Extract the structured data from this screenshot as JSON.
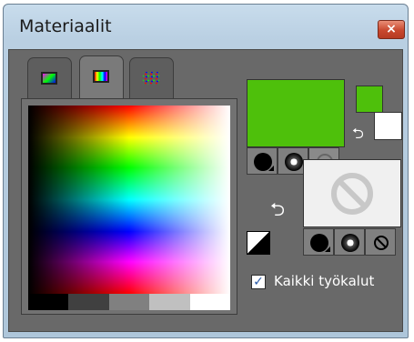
{
  "window": {
    "title": "Materiaalit",
    "close_label": "×"
  },
  "tabs": [
    {
      "name": "frame-tab-icon"
    },
    {
      "name": "gradient-tab-icon"
    },
    {
      "name": "pattern-tab-icon"
    }
  ],
  "colors": {
    "foreground": "#4ec00b",
    "background": "#ffffff",
    "grays": [
      "#000000",
      "#404040",
      "#808080",
      "#c0c0c0",
      "#ffffff"
    ]
  },
  "icons": {
    "swap": "⮌",
    "check": "✓",
    "none": "no-symbol"
  },
  "options": {
    "all_tools_label": "Kaikki työkalut",
    "all_tools_checked": true
  }
}
